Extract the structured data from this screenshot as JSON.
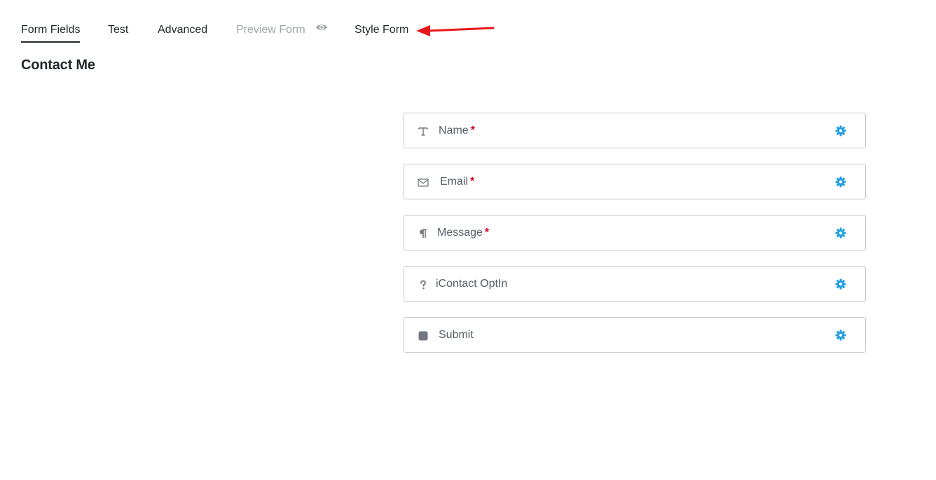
{
  "tabs": [
    {
      "label": "Form Fields",
      "active": true
    },
    {
      "label": "Test"
    },
    {
      "label": "Advanced"
    },
    {
      "label": "Preview Form",
      "disabled": true,
      "icon": "eye-icon"
    },
    {
      "label": "Style Form"
    }
  ],
  "form": {
    "title": "Contact Me"
  },
  "fields": [
    {
      "label": "Name",
      "required_mark": "*",
      "icon": "text-field-icon"
    },
    {
      "label": "Email",
      "required_mark": "*",
      "icon": "envelope-icon"
    },
    {
      "label": "Message",
      "required_mark": "*",
      "icon": "paragraph-icon"
    },
    {
      "label": "iContact OptIn",
      "icon": "question-icon"
    },
    {
      "label": "Submit",
      "icon": "square-icon"
    }
  ],
  "colors": {
    "gear": "#1e9ee0",
    "required": "#d0021b",
    "annotation_arrow": "#e8171b"
  }
}
